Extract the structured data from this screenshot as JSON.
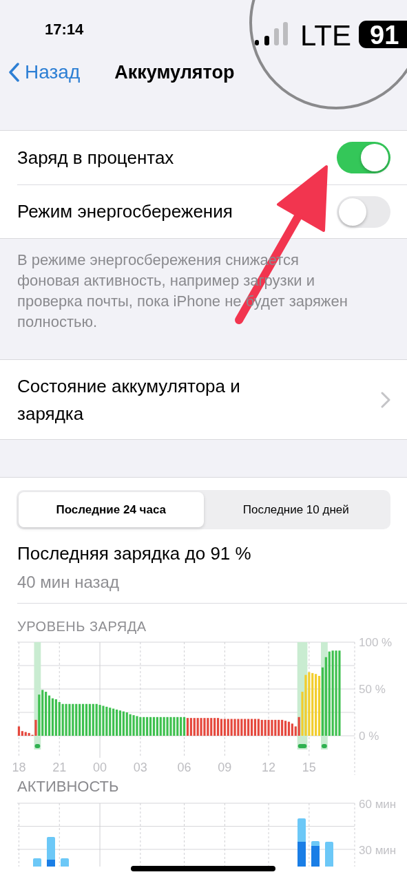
{
  "status_bar": {
    "time": "17:14"
  },
  "magnifier": {
    "network": "LTE",
    "battery": "91"
  },
  "nav": {
    "back": "Назад",
    "title": "Аккумулятор"
  },
  "settings": [
    {
      "label": "Заряд в процентах",
      "on": true
    },
    {
      "label": "Режим энергосбережения",
      "on": false
    }
  ],
  "settings_note": "В режиме энергосбережения снижается фоновая активность, например загрузки и проверка почты, пока iPhone не будет заряжен полностью.",
  "health_link": {
    "label": "Состояние аккумулятора и зарядка"
  },
  "periods": [
    {
      "label": "Последние 24 часа",
      "selected": true
    },
    {
      "label": "Последние 10 дней",
      "selected": false
    }
  ],
  "last_charge": {
    "title": "Последняя зарядка до 91 %",
    "time": "40 мин назад"
  },
  "battery_level": {
    "heading": "УРОВЕНЬ ЗАРЯДА",
    "chart_data": {
      "type": "bar",
      "grid": true,
      "ylim": [
        0,
        100
      ],
      "categories": [
        "18",
        null,
        null,
        null,
        null,
        null,
        null,
        null,
        null,
        null,
        null,
        null,
        "21",
        null,
        null,
        null,
        null,
        null,
        null,
        null,
        null,
        null,
        null,
        null,
        "00",
        null,
        null,
        null,
        null,
        null,
        null,
        null,
        null,
        null,
        null,
        null,
        "03",
        null,
        null,
        null,
        null,
        null,
        null,
        null,
        null,
        null,
        null,
        null,
        null,
        "06",
        null,
        null,
        null,
        null,
        null,
        null,
        null,
        null,
        null,
        null,
        null,
        "09",
        null,
        null,
        null,
        null,
        null,
        null,
        null,
        null,
        null,
        null,
        null,
        null,
        "12",
        null,
        null,
        null,
        null,
        null,
        null,
        null,
        null,
        null,
        null,
        null,
        "15",
        null,
        null,
        null,
        null,
        null,
        null,
        null,
        null,
        null
      ],
      "yticks": [
        {
          "value": 0,
          "label": "0 %"
        },
        {
          "value": 50,
          "label": "50 %"
        },
        {
          "value": 100,
          "label": "100 %"
        }
      ],
      "series": [
        {
          "color": "#e5483d",
          "values": [
            10,
            5,
            4,
            3,
            1,
            17,
            null,
            null,
            null,
            null,
            null,
            null,
            null,
            null,
            null,
            null,
            null,
            null,
            null,
            null,
            null,
            null,
            null,
            null,
            null,
            null,
            null,
            null,
            null,
            null,
            null,
            null,
            null,
            null,
            null,
            null,
            null,
            null,
            null,
            null,
            null,
            null,
            null,
            null,
            null,
            null,
            null,
            null,
            null,
            null,
            19,
            19,
            19,
            19,
            19,
            19,
            19,
            19,
            19,
            19,
            18,
            18,
            18,
            18,
            18,
            18,
            18,
            18,
            18,
            18,
            18,
            18,
            17,
            17,
            17,
            17,
            17,
            17,
            17,
            16,
            15,
            13,
            10,
            20,
            null,
            null,
            null,
            null,
            null,
            null,
            null,
            null,
            null,
            null,
            null,
            null
          ]
        },
        {
          "color": "#3ec04f",
          "values": [
            null,
            null,
            null,
            null,
            null,
            null,
            44,
            49,
            47,
            43,
            40,
            39,
            36,
            34,
            34,
            34,
            34,
            34,
            34,
            34,
            34,
            34,
            34,
            34,
            33,
            32,
            31,
            30,
            29,
            28,
            27,
            26,
            25,
            23,
            22,
            21,
            20,
            20,
            20,
            20,
            20,
            20,
            20,
            20,
            20,
            20,
            20,
            20,
            20,
            20,
            null,
            null,
            null,
            null,
            null,
            null,
            null,
            null,
            null,
            null,
            null,
            null,
            null,
            null,
            null,
            null,
            null,
            null,
            null,
            null,
            null,
            null,
            null,
            null,
            null,
            null,
            null,
            null,
            null,
            null,
            null,
            null,
            null,
            null,
            null,
            null,
            null,
            null,
            null,
            null,
            73,
            84,
            90,
            91,
            91,
            91
          ]
        },
        {
          "color": "#f2cd2b",
          "values": [
            null,
            null,
            null,
            null,
            null,
            null,
            null,
            null,
            null,
            null,
            null,
            null,
            null,
            null,
            null,
            null,
            null,
            null,
            null,
            null,
            null,
            null,
            null,
            null,
            null,
            null,
            null,
            null,
            null,
            null,
            null,
            null,
            null,
            null,
            null,
            null,
            null,
            null,
            null,
            null,
            null,
            null,
            null,
            null,
            null,
            null,
            null,
            null,
            null,
            null,
            null,
            null,
            null,
            null,
            null,
            null,
            null,
            null,
            null,
            null,
            null,
            null,
            null,
            null,
            null,
            null,
            null,
            null,
            null,
            null,
            null,
            null,
            null,
            null,
            null,
            null,
            null,
            null,
            null,
            null,
            null,
            null,
            null,
            null,
            47,
            65,
            68,
            67,
            66,
            64,
            null,
            null,
            null,
            null,
            null,
            null
          ]
        }
      ]
    }
  },
  "activity": {
    "heading": "АКТИВНОСТЬ",
    "tick_labels": [
      "60 мин",
      "30 мин"
    ]
  }
}
